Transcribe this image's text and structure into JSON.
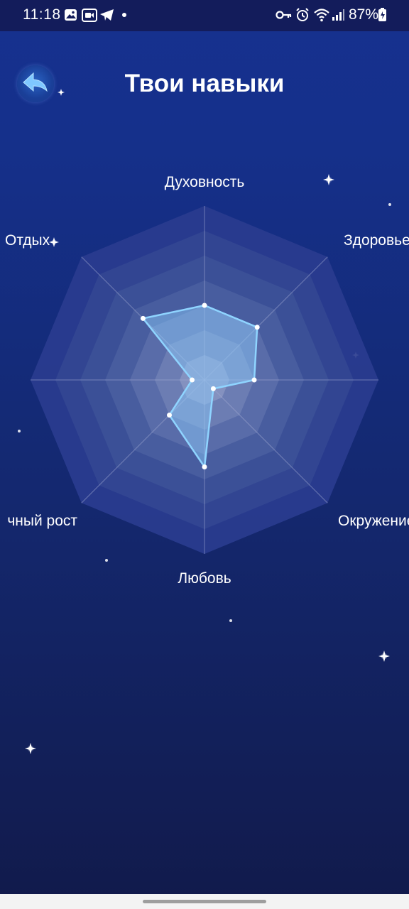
{
  "status_bar": {
    "time": "11:18",
    "battery": "87%",
    "left_icons": [
      "gallery-icon",
      "video-icon",
      "telegram-icon",
      "dot-icon"
    ],
    "right_icons": [
      "key-icon",
      "alarm-icon",
      "wifi-icon",
      "signal-icon",
      "battery-icon"
    ]
  },
  "header": {
    "title": "Твои навыки",
    "back_icon": "back-arrow-icon"
  },
  "colors": {
    "background_top": "#16318f",
    "background_bottom": "#111a4b",
    "series_line": "#8fd4ff",
    "series_fill": "#8fd0ff"
  },
  "chart_data": {
    "type": "radar",
    "axes": [
      "Духовность",
      "Здоровье",
      "Окружение",
      "Любовь",
      "Личный рост",
      "Отдых"
    ],
    "visible_axis_labels": [
      "Духовность",
      "Здоровье",
      "Окружение",
      "Любовь",
      "чный рост",
      "Отдых"
    ],
    "rings": 7,
    "range": [
      0,
      7
    ],
    "values": [
      3,
      3,
      2,
      0.5,
      3.5,
      2,
      0.5,
      3.5
    ]
  }
}
